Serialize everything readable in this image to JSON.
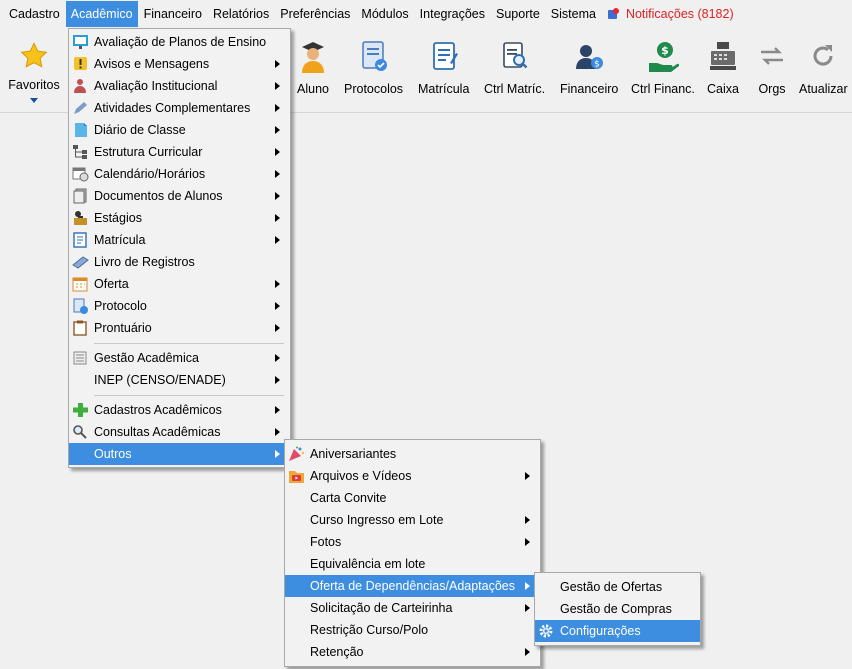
{
  "menubar": {
    "items": [
      "Cadastro",
      "Acadêmico",
      "Financeiro",
      "Relatórios",
      "Preferências",
      "Módulos",
      "Integrações",
      "Suporte",
      "Sistema"
    ],
    "notifications": "Notificações (8182)"
  },
  "toolbar": {
    "favoritos": "Favoritos",
    "buttons": [
      "Aluno",
      "Protocolos",
      "Matrícula",
      "Ctrl Matríc.",
      "Financeiro",
      "Ctrl Financ.",
      "Caixa",
      "Orgs",
      "Atualizar"
    ]
  },
  "menu_academico": {
    "items": [
      "Avaliação de Planos de Ensino",
      "Avisos e Mensagens",
      "Avaliação Institucional",
      "Atividades Complementares",
      "Diário de Classe",
      "Estrutura Curricular",
      "Calendário/Horários",
      "Documentos de Alunos",
      "Estágios",
      "Matrícula",
      "Livro de Registros",
      "Oferta",
      "Protocolo",
      "Prontuário",
      "Gestão Acadêmica",
      "INEP (CENSO/ENADE)",
      "Cadastros Acadêmicos",
      "Consultas Acadêmicas",
      "Outros"
    ]
  },
  "menu_outros": {
    "items": [
      "Aniversariantes",
      "Arquivos e Vídeos",
      "Carta Convite",
      "Curso Ingresso em Lote",
      "Fotos",
      "Equivalência em lote",
      "Oferta de Dependências/Adaptações",
      "Solicitação de Carteirinha",
      "Restrição Curso/Polo",
      "Retenção"
    ]
  },
  "menu_oferta": {
    "items": [
      "Gestão de Ofertas",
      "Gestão de Compras",
      "Configurações"
    ]
  },
  "colors": {
    "highlight": "#3d8ee0",
    "notification": "#dd2222",
    "menu_bg": "#f2f2f2"
  }
}
